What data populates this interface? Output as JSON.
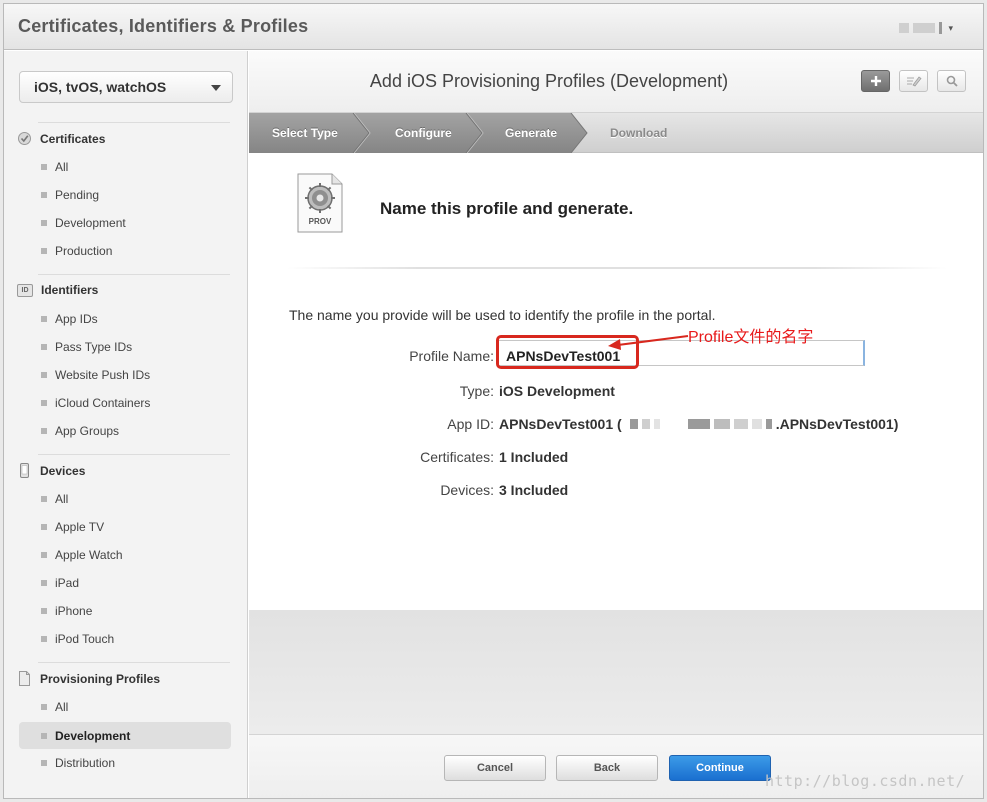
{
  "header": {
    "app_title": "Certificates, Identifiers & Profiles",
    "account_caret": "▾"
  },
  "sidebar": {
    "platform_select": "iOS, tvOS, watchOS",
    "sections": [
      {
        "title": "Certificates",
        "icon": "certificate-icon",
        "items": [
          "All",
          "Pending",
          "Development",
          "Production"
        ]
      },
      {
        "title": "Identifiers",
        "icon": "id-icon",
        "icon_text": "ID",
        "items": [
          "App IDs",
          "Pass Type IDs",
          "Website Push IDs",
          "iCloud Containers",
          "App Groups"
        ]
      },
      {
        "title": "Devices",
        "icon": "device-icon",
        "items": [
          "All",
          "Apple TV",
          "Apple Watch",
          "iPad",
          "iPhone",
          "iPod Touch"
        ]
      },
      {
        "title": "Provisioning Profiles",
        "icon": "document-icon",
        "items": [
          "All",
          "Development",
          "Distribution"
        ]
      }
    ],
    "active_item": "Development"
  },
  "main": {
    "title": "Add iOS Provisioning Profiles (Development)",
    "toolbar_icons": [
      "plus-icon",
      "edit-icon",
      "search-icon"
    ],
    "steps": [
      "Select Type",
      "Configure",
      "Generate",
      "Download"
    ],
    "active_step": "Generate",
    "prov_icon_label": "PROV",
    "heading": "Name this profile and generate.",
    "intro": "The name you provide will be used to identify the profile in the portal.",
    "fields": {
      "profile_name_label": "Profile Name:",
      "profile_name_value": "APNsDevTest001",
      "type_label": "Type:",
      "type_value": "iOS Development",
      "app_id_label": "App ID:",
      "app_id_prefix": "APNsDevTest001 (",
      "app_id_suffix": ".APNsDevTest001)",
      "certificates_label": "Certificates:",
      "certificates_value": "1 Included",
      "devices_label": "Devices:",
      "devices_value": "3 Included"
    },
    "annotation": "Profile文件的名字",
    "annotation_color": "#e8191a"
  },
  "footer": {
    "cancel": "Cancel",
    "back": "Back",
    "continue": "Continue",
    "primary_color": "#1a6fd0"
  },
  "watermark": "http://blog.csdn.net/"
}
